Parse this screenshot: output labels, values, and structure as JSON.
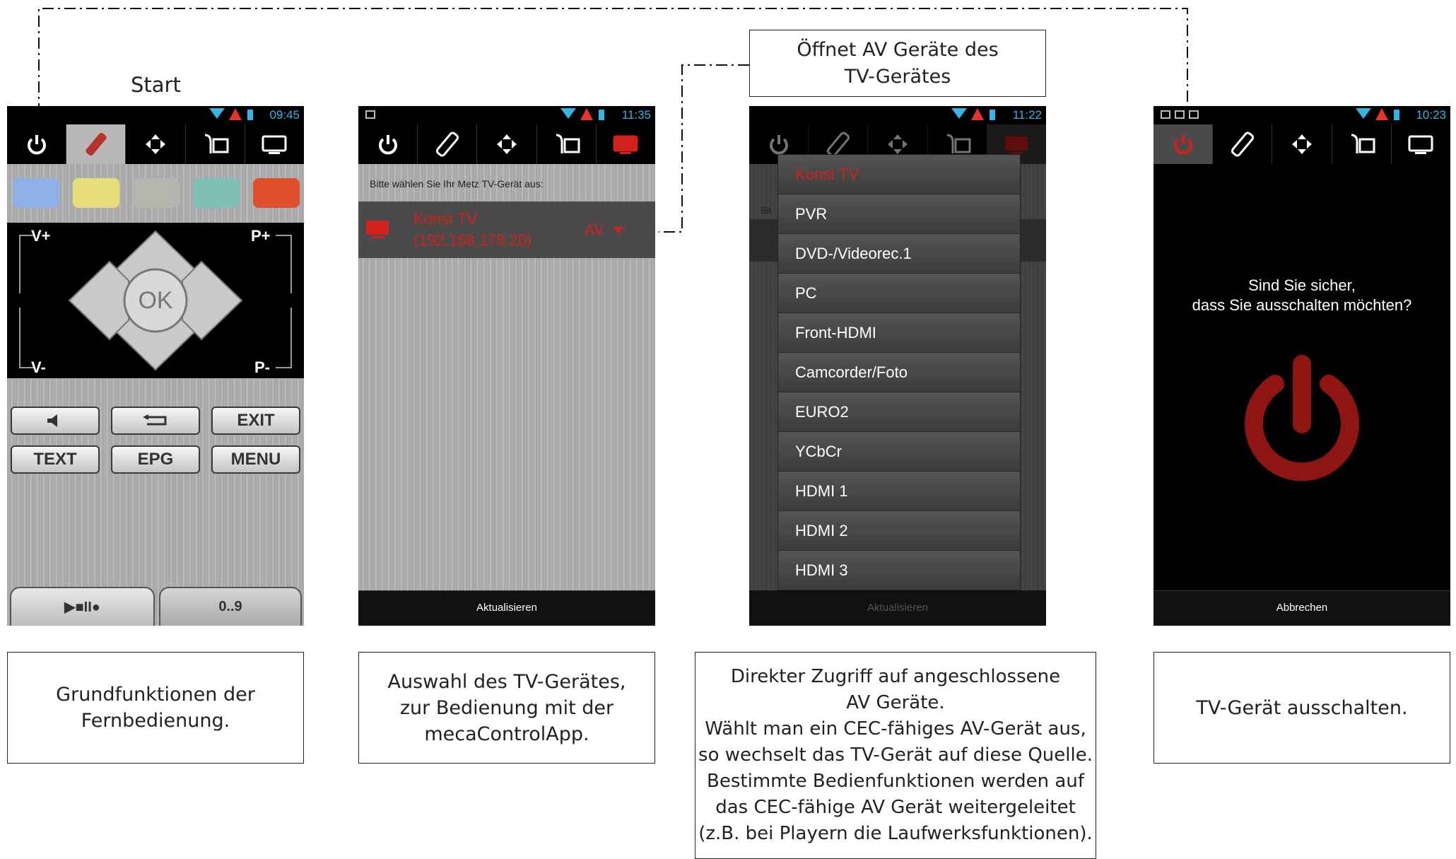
{
  "top_labels": {
    "start": "Start",
    "av_note": "Öffnet AV Geräte des\nTV-Gerätes"
  },
  "screen1": {
    "status_time": "09:45",
    "color_buttons": [
      "#8fb0e6",
      "#e6de7a",
      "#b5b5ad",
      "#7fc0b6",
      "#e0502e"
    ],
    "dpad": {
      "ok": "OK",
      "vplus": "V+",
      "vminus": "V-",
      "pplus": "P+",
      "pminus": "P-"
    },
    "buttons": {
      "mute": "mute",
      "back": "back",
      "exit": "EXIT",
      "text": "TEXT",
      "epg": "EPG",
      "menu": "MENU"
    },
    "bottom_tabs": {
      "media": "▶■II●",
      "digits": "0..9"
    }
  },
  "screen2": {
    "status_time": "11:35",
    "prompt": "Bitte wählen Sie Ihr Metz TV-Gerät aus:",
    "device_name": "Konst TV",
    "device_ip": "(192.168.178.20)",
    "av_label": "AV",
    "footer": "Aktualisieren"
  },
  "screen3": {
    "status_time": "11:22",
    "menu_items": [
      "Konst TV",
      "PVR",
      "DVD-/Videorec.1",
      "PC",
      "Front-HDMI",
      "Camcorder/Foto",
      "EURO2",
      "YCbCr",
      "HDMI 1",
      "HDMI 2",
      "HDMI 3"
    ],
    "bg_prompt_fragment": "Bit",
    "footer": "Aktualisieren"
  },
  "screen4": {
    "status_time": "10:23",
    "message": "Sind Sie sicher,\ndass Sie ausschalten möchten?",
    "footer": "Abbrechen"
  },
  "captions": {
    "c1": "Grundfunktionen der\nFernbedienung.",
    "c2": "Auswahl des TV-Gerätes,\nzur Bedienung mit der\nmecaControlApp.",
    "c3": "Direkter Zugriff auf angeschlossene\nAV Geräte.\nWählt man ein CEC-fähiges AV-Gerät aus,\nso wechselt das TV-Gerät auf diese Quelle.\nBestimmte Bedienfunktionen werden auf\ndas CEC-fähige AV Gerät weitergeleitet\n(z.B. bei Playern die Laufwerksfunktionen).",
    "c4": "TV-Gerät ausschalten."
  },
  "colors": {
    "accent_red": "#d2201c",
    "status_blue": "#33b5e5"
  }
}
